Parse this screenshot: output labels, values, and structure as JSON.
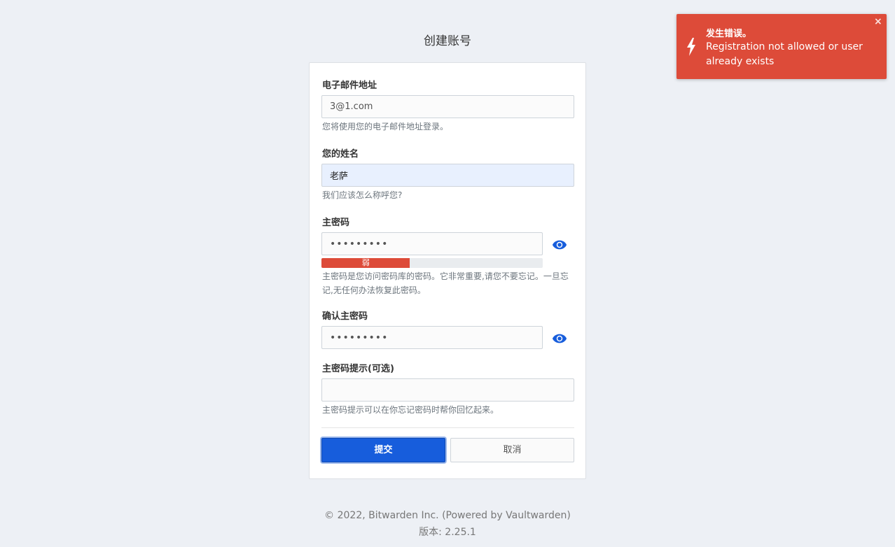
{
  "page": {
    "title": "创建账号"
  },
  "form": {
    "email": {
      "label": "电子邮件地址",
      "value": "3@1.com",
      "help": "您将使用您的电子邮件地址登录。"
    },
    "name": {
      "label": "您的姓名",
      "value": "老萨",
      "help": "我们应该怎么称呼您?"
    },
    "master_password": {
      "label": "主密码",
      "value": "•••••••••",
      "strength_label": "弱",
      "strength_fraction": 0.4,
      "help": "主密码是您访问密码库的密码。它非常重要,请您不要忘记。一旦忘记,无任何办法恢复此密码。"
    },
    "confirm_password": {
      "label": "确认主密码",
      "value": "•••••••••"
    },
    "hint": {
      "label": "主密码提示(可选)",
      "value": "",
      "help": "主密码提示可以在你忘记密码时帮你回忆起来。"
    },
    "submit_label": "提交",
    "cancel_label": "取消"
  },
  "footer": {
    "copyright": "© 2022, Bitwarden Inc. (Powered by Vaultwarden)",
    "version": "版本: 2.25.1"
  },
  "toast": {
    "title": "发生错误。",
    "message": "Registration not allowed or user already exists",
    "close": "×",
    "icon": "lightning-icon"
  },
  "colors": {
    "primary": "#175ddc",
    "danger": "#dd4b39",
    "background": "#edf0f5"
  }
}
